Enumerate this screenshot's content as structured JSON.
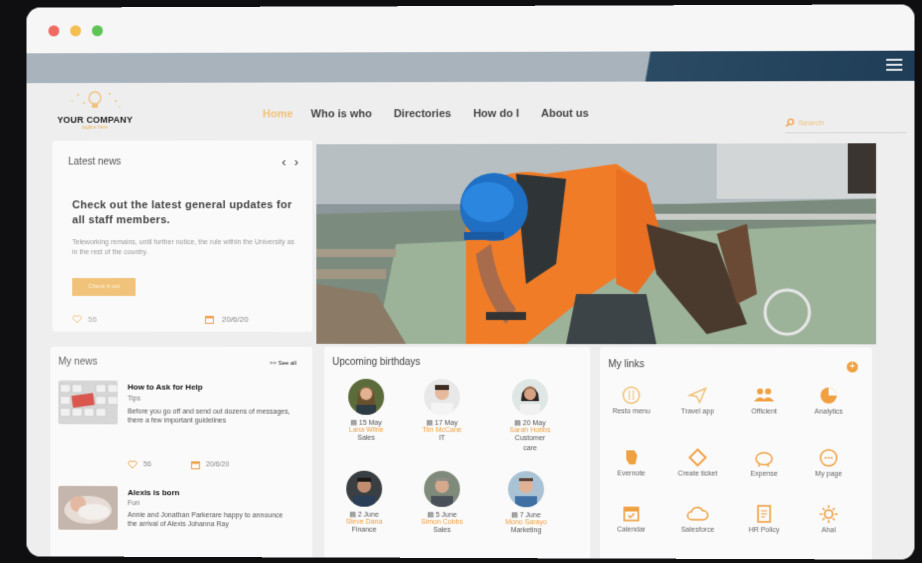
{
  "window": {
    "controls": [
      "close",
      "minimize",
      "maximize"
    ]
  },
  "brand": {
    "name": "YOUR COMPANY",
    "tagline": "tagline here"
  },
  "nav": {
    "items": [
      {
        "label": "Home",
        "active": true
      },
      {
        "label": "Who is who"
      },
      {
        "label": "Directories"
      },
      {
        "label": "How do I"
      },
      {
        "label": "About us"
      }
    ],
    "search_placeholder": "Search"
  },
  "latest_news": {
    "title": "Latest news",
    "headline": "Check out the latest general updates for all staff members.",
    "body": "Teleworking remains, until further notice, the rule within the University as in the rest of the country.",
    "cta": "Check it out",
    "likes": "56",
    "date": "20/6/20"
  },
  "my_news": {
    "title": "My news",
    "see_all": ">> See all",
    "items": [
      {
        "title": "How to Ask for Help",
        "category": "Tips",
        "excerpt": "Before you go off and send out dozens of messages, there a few important guidelines",
        "likes": "56",
        "date": "20/6/20"
      },
      {
        "title": "Alexis is born",
        "category": "Fun",
        "excerpt": "Annie and Jonathan Parkerare happy to announce the arrival of Alexis Johanna Ray"
      }
    ]
  },
  "birthdays": {
    "title": "Upcoming birthdays",
    "people": [
      {
        "date": "15 May",
        "name": "Lana Wilne",
        "dept": "Sales"
      },
      {
        "date": "17 May",
        "name": "Tim McCane",
        "dept": "IT"
      },
      {
        "date": "20 May",
        "name": "Sarah Hobbs",
        "dept": "Customer care"
      },
      {
        "date": "2 June",
        "name": "Steve Dana",
        "dept": "Finance"
      },
      {
        "date": "5 June",
        "name": "Simon Cobbs",
        "dept": "Sales"
      },
      {
        "date": "7 June",
        "name": "Mono Sarayo",
        "dept": "Marketing"
      }
    ]
  },
  "my_links": {
    "title": "My links",
    "add": "+",
    "items": [
      {
        "label": "Resto menu",
        "icon": "restaurant-icon"
      },
      {
        "label": "Travel app",
        "icon": "paper-plane-icon"
      },
      {
        "label": "Officient",
        "icon": "people-icon"
      },
      {
        "label": "Analytics",
        "icon": "pie-chart-icon"
      },
      {
        "label": "Evernote",
        "icon": "evernote-icon"
      },
      {
        "label": "Create ticket",
        "icon": "diamond-icon"
      },
      {
        "label": "Expense",
        "icon": "piggy-bank-icon"
      },
      {
        "label": "My page",
        "icon": "chat-bubble-icon"
      },
      {
        "label": "Calendar",
        "icon": "calendar-icon"
      },
      {
        "label": "Salesforce",
        "icon": "cloud-icon"
      },
      {
        "label": "HR Policy",
        "icon": "document-icon"
      },
      {
        "label": "Ahal",
        "icon": "sun-icon"
      }
    ]
  },
  "colors": {
    "accent": "#f0c27a",
    "accent_dark": "#f0a040",
    "banner": "#1f3d56"
  }
}
